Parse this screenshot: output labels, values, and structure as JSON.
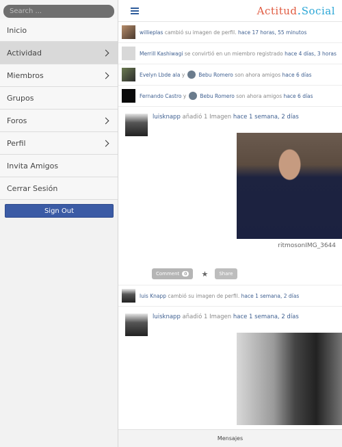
{
  "sidebar": {
    "search_placeholder": "Search ...",
    "items": [
      {
        "label": "Inicio",
        "chevron": false,
        "active": false
      },
      {
        "label": "Actividad",
        "chevron": true,
        "active": true
      },
      {
        "label": "Miembros",
        "chevron": true,
        "active": false
      },
      {
        "label": "Grupos",
        "chevron": false,
        "active": false
      },
      {
        "label": "Foros",
        "chevron": true,
        "active": false
      },
      {
        "label": "Perfil",
        "chevron": true,
        "active": false
      },
      {
        "label": "Invita Amigos",
        "chevron": false,
        "active": false
      },
      {
        "label": "Cerrar Sesión",
        "chevron": false,
        "active": false
      }
    ],
    "signout_label": "Sign Out"
  },
  "header": {
    "brand_part1": "Actitud",
    "brand_part2": "Social"
  },
  "activities": [
    {
      "user": "willieplas",
      "text": "cambió su imagen de perfil.",
      "time": "hace 17 horas, 55 minutos"
    },
    {
      "user": "Merrill Kashiwagi",
      "text": "se convirtió en un miembro registrado",
      "time": "hace 4 días, 3 horas"
    },
    {
      "user": "Evelyn Lbde ala",
      "joiner": "y",
      "user2": "Bebu Romero",
      "text": "son ahora amigos",
      "time": "hace 6 días"
    },
    {
      "user": "Fernando Castro",
      "joiner": "y",
      "user2": "Bebu Romero",
      "text": "son ahora amigos",
      "time": "hace 6 días"
    }
  ],
  "post1": {
    "user": "luisknapp",
    "text": "añadió 1 Imagen",
    "time": "hace 1 semana, 2 días",
    "caption": "ritmosonIMG_3644",
    "comment_label": "Comment",
    "comment_count": "0",
    "share_label": "Share"
  },
  "activity5": {
    "user": "luis Knapp",
    "text": "cambió su imagen de perfil.",
    "time": "hace 1 semana, 2 días"
  },
  "post2": {
    "user": "luisknapp",
    "text": "añadió 1 Imagen",
    "time": "hace 1 semana, 2 días"
  },
  "bottombar": {
    "label": "Mensajes"
  }
}
